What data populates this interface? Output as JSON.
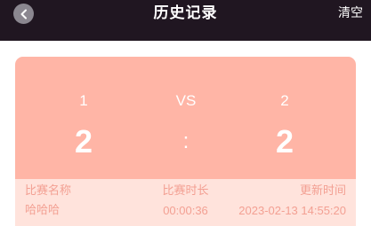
{
  "header": {
    "title": "历史记录",
    "clear_label": "清空"
  },
  "record": {
    "team_a_label": "1",
    "vs_label": "VS",
    "team_b_label": "2",
    "team_a_score": "2",
    "separator": ":",
    "team_b_score": "2",
    "columns": {
      "name": "比赛名称",
      "duration": "比赛时长",
      "updated": "更新时间"
    },
    "values": {
      "name": "哈哈哈",
      "duration": "00:00:36",
      "updated": "2023-02-13 14:55:20"
    }
  },
  "colors": {
    "nav_background": "#201621",
    "score_panel": "#ffb5a6",
    "info_panel": "#ffe3dc",
    "info_text": "#f3a093"
  },
  "icons": {
    "back": "chevron-left-icon"
  }
}
